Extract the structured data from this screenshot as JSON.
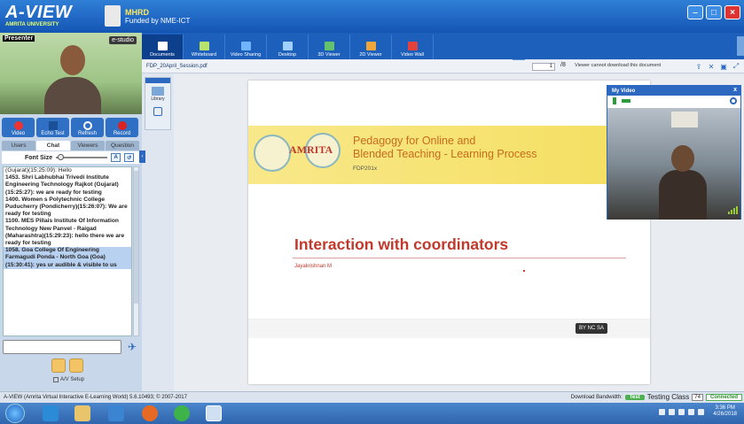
{
  "header": {
    "brand": "A-VIEW",
    "university": "AMRITA UNIVERSITY",
    "mhrd": "MHRD",
    "funded": "Funded by NME-ICT",
    "window_buttons": [
      "minimize-icon",
      "maximize-icon",
      "close-icon"
    ]
  },
  "presenter": {
    "label": "Presenter",
    "badge": "e-studio",
    "buttons": [
      {
        "label": "Video"
      },
      {
        "label": "Echo Test"
      },
      {
        "label": "Refresh"
      },
      {
        "label": "Record"
      }
    ]
  },
  "left_tabs": [
    "Users",
    "Chat",
    "Viewers",
    "Question"
  ],
  "font_size_label": "Font Size",
  "chat_messages": [
    {
      "text": "(Gujarat)(15:25:09): Hello",
      "alt": false
    },
    {
      "text": "1453. Shri Labhubhai Trivedi Institute Engineering Technology Rajkot (Gujarat)(15:25:27): we are ready for testing",
      "alt": false
    },
    {
      "text": "1400. Women s Polytechnic College Puducherry (Pondicherry)(15:26:07): We are ready for testing",
      "alt": false
    },
    {
      "text": "1100. MES Pillais Institute Of Information Technology New Panvel - Raigad (Maharashtra)(15:29:23): hello there we are ready for testing",
      "alt": false
    },
    {
      "text": "1058. Goa College Of Engineering Farmagudi Ponda - North Goa (Goa)(15:30:41): yes ur audible & visible to us",
      "alt": true
    }
  ],
  "av_setup": "A/V Setup",
  "toolbar": {
    "tools": [
      {
        "label": "Documents",
        "active": true,
        "color": "#ffffff"
      },
      {
        "label": "Whiteboard",
        "active": false,
        "color": "#b7e36c"
      },
      {
        "label": "Video Sharing",
        "active": false,
        "color": "#6fb6ff"
      },
      {
        "label": "Desktop",
        "active": false,
        "color": "#9fd0ff"
      },
      {
        "label": "3D Viewer",
        "active": false,
        "color": "#63c26b"
      },
      {
        "label": "2D Viewer",
        "active": false,
        "color": "#f0a63a"
      },
      {
        "label": "Video Wall",
        "active": false,
        "color": "#e3413b"
      }
    ]
  },
  "docbar": {
    "filename": "FDP_20April_Session.pdf",
    "page": "1",
    "separator": "/8",
    "note": "Viewer cannot download this document"
  },
  "library": {
    "label": "Library"
  },
  "slide": {
    "banner_title_1": "Pedagogy for Online and",
    "banner_title_2": "Blended Teaching - Learning Process",
    "banner_sub": "FDP201x",
    "amrita_mark": "AMRITA",
    "title": "Interaction with coordinators",
    "author": "Jayakrishnan M",
    "cc": "BY NC SA"
  },
  "my_video": {
    "title": "My Video",
    "close": "x"
  },
  "status": {
    "left": "A-VIEW (Amrita Virtual Interactive E-Learning World) 5.6.10493; © 2007-2017",
    "download_bandwidth": "Download Bandwidth:",
    "test": "Test",
    "testing_class": "Testing Class",
    "count": "74",
    "connected": "Connected"
  },
  "taskbar": {
    "time": "3:36 PM",
    "date": "4/26/2018"
  }
}
